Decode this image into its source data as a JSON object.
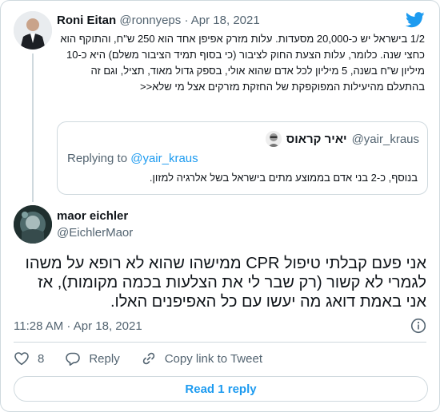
{
  "parent": {
    "name": "Roni Eitan",
    "handle": "@ronnyeps",
    "separator": "·",
    "date": "Apr 18, 2021",
    "text": "1/2 בישראל יש כ-20,000 מסעדות. עלות מזרק אפיפן אחד הוא 250 ש\"ח, והתוקף הוא כחצי שנה. כלומר, עלות הצעת החוק לציבור (כי בסוף תמיד הציבור משלם) היא כ-10 מיליון ש\"ח בשנה, 5 מיליון לכל אדם שהוא אולי, בספק גדול מאוד, תציל, וגם זה בהתעלם מהיעילות המפוקפקת של החזקת מזרקים אצל מי שלא<<"
  },
  "quote": {
    "name": "יאיר קראוס",
    "handle": "@yair_kraus",
    "replying_prefix": "Replying to",
    "replying_handle": "@yair_kraus",
    "text": "בנוסף, כ-2 בני אדם בממוצע מתים בישראל בשל אלרגיה למזון."
  },
  "main": {
    "name": "maor eichler",
    "handle": "@EichlerMaor",
    "text": "אני פעם קבלתי טיפול CPR ממישהו שהוא לא רופא על משהו לגמרי לא קשור (רק שבר לי את הצלעות בכמה מקומות), אז אני באמת דואג מה יעשו עם כל האפיפנים האלו.",
    "timestamp": "11:28 AM · Apr 18, 2021"
  },
  "actions": {
    "like_count": "8",
    "reply_label": "Reply",
    "copy_label": "Copy link to Tweet"
  },
  "read_reply_label": "Read 1 reply",
  "colors": {
    "accent": "#1d9bf0",
    "muted": "#536471",
    "border": "#cfd9de"
  },
  "icons": [
    "twitter-bird-icon",
    "info-icon",
    "heart-icon",
    "reply-icon",
    "link-icon"
  ]
}
